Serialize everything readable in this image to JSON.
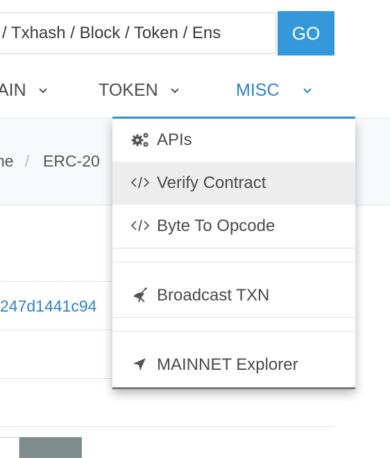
{
  "search": {
    "placeholder": "/ Txhash / Block / Token / Ens",
    "go_label": "GO"
  },
  "nav": {
    "items": [
      {
        "label": "AIN"
      },
      {
        "label": "TOKEN"
      },
      {
        "label": "MISC"
      }
    ]
  },
  "breadcrumb": {
    "items": [
      "ne",
      "ERC-20"
    ],
    "separator": "/"
  },
  "content": {
    "hash_link": "247d1441c94"
  },
  "dropdown": {
    "items": [
      {
        "label": "APIs",
        "icon": "gears-icon"
      },
      {
        "label": "Verify Contract",
        "icon": "code-icon"
      },
      {
        "label": "Byte To Opcode",
        "icon": "code-icon"
      },
      {
        "label": "Broadcast TXN",
        "icon": "satellite-dish-icon"
      },
      {
        "label": "MAINNET Explorer",
        "icon": "location-arrow-icon"
      }
    ]
  },
  "colors": {
    "accent": "#3498db",
    "link": "#2e83c8",
    "text": "#4a4a4a",
    "hover_bg": "#ededed"
  }
}
